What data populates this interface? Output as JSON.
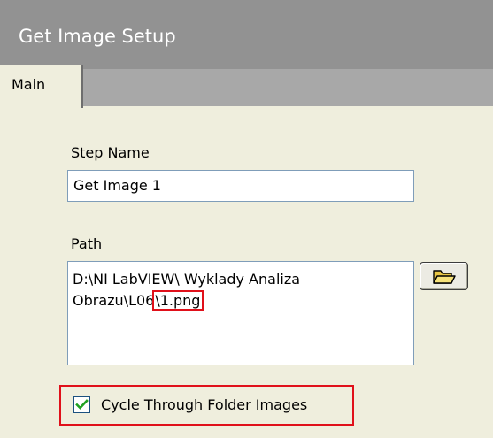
{
  "window": {
    "title": "Get Image Setup"
  },
  "tabs": [
    {
      "label": "Main",
      "selected": true
    }
  ],
  "step_name": {
    "label": "Step Name",
    "value": "Get Image 1"
  },
  "path": {
    "label": "Path",
    "line1": "D:\\NI LabVIEW\\ Wyklady Analiza",
    "line2_prefix": "Obrazu\\L06",
    "line2_highlight": "\\1.png",
    "browse_icon": "folder-open-icon"
  },
  "cycle_option": {
    "label": "Cycle Through Folder Images",
    "checked": true,
    "checkbox_icon": "checkmark-icon"
  },
  "colors": {
    "title_bar": "#929292",
    "tab_strip": "#a8a8a8",
    "panel_background": "#efeedd",
    "highlight_outline": "#e0101a",
    "checkmark": "#21a121"
  }
}
